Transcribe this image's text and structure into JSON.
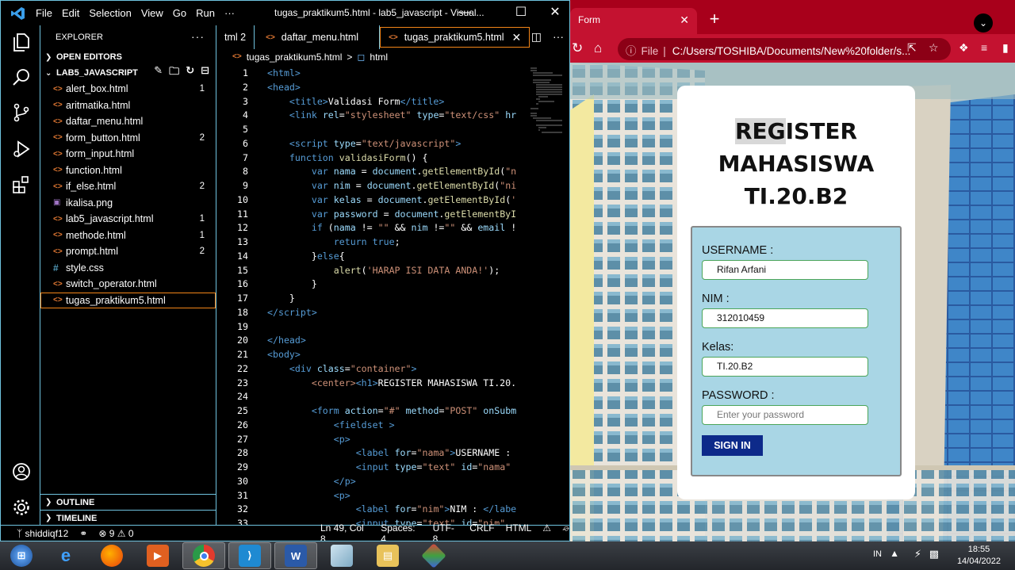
{
  "vscode": {
    "menu": [
      "File",
      "Edit",
      "Selection",
      "View",
      "Go",
      "Run",
      "···"
    ],
    "title": "tugas_praktikum5.html - lab5_javascript - Visual...",
    "explorer": {
      "header": "EXPLORER",
      "open_editors": "OPEN EDITORS",
      "folder": "LAB5_JAVASCRIPT",
      "files": [
        {
          "name": "alert_box.html",
          "badge": "1"
        },
        {
          "name": "aritmatika.html",
          "badge": ""
        },
        {
          "name": "daftar_menu.html",
          "badge": ""
        },
        {
          "name": "form_button.html",
          "badge": "2"
        },
        {
          "name": "form_input.html",
          "badge": ""
        },
        {
          "name": "function.html",
          "badge": ""
        },
        {
          "name": "if_else.html",
          "badge": "2"
        },
        {
          "name": "ikalisa.png",
          "badge": ""
        },
        {
          "name": "lab5_javascript.html",
          "badge": "1"
        },
        {
          "name": "methode.html",
          "badge": "1"
        },
        {
          "name": "prompt.html",
          "badge": "2"
        },
        {
          "name": "style.css",
          "badge": ""
        },
        {
          "name": "switch_operator.html",
          "badge": ""
        },
        {
          "name": "tugas_praktikum5.html",
          "badge": ""
        }
      ],
      "outline": "OUTLINE",
      "timeline": "TIMELINE"
    },
    "tabs": [
      {
        "label": "tml",
        "badge": "2"
      },
      {
        "label": "daftar_menu.html"
      },
      {
        "label": "tugas_praktikum5.html"
      }
    ],
    "breadcrumb": [
      "tugas_praktikum5.html",
      ">",
      "html"
    ],
    "statusbar": {
      "branch": "shiddiqf12",
      "problems": "⊗ 9 ⚠ 0",
      "position": "Ln 49, Col 8",
      "spaces": "Spaces: 4",
      "encoding": "UTF-8",
      "eol": "CRLF",
      "language": "HTML"
    }
  },
  "browser": {
    "tab_title": "Form",
    "url_prefix": "File",
    "url": "C:/Users/TOSHIBA/Documents/New%20folder/s...",
    "page": {
      "heading_hl": "REG",
      "heading_rest": "ISTER",
      "heading_line2": "MAHASISWA",
      "heading_line3": "TI.20.B2",
      "username_label": "USERNAME :",
      "username_value": "Rifan Arfani",
      "nim_label": "NIM :",
      "nim_value": "312010459",
      "kelas_label": "Kelas:",
      "kelas_value": "TI.20.B2",
      "password_label": "PASSWORD :",
      "password_placeholder": "Enter your password",
      "signin_label": "SIGN IN"
    }
  },
  "taskbar": {
    "lang": "IN",
    "time": "18:55",
    "date": "14/04/2022"
  }
}
